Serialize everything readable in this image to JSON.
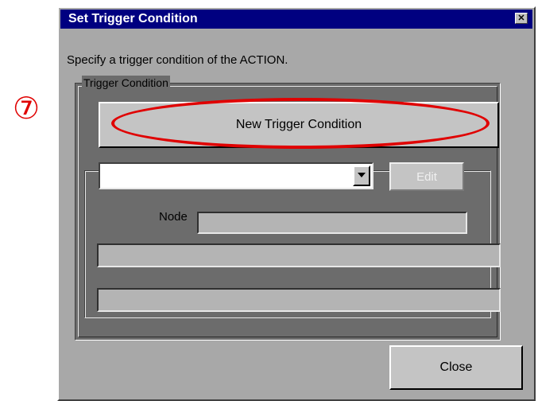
{
  "annotation": {
    "step_marker": "⑦",
    "highlight_color": "#e00000"
  },
  "window": {
    "title": "Set Trigger Condition",
    "close_glyph": "✕",
    "titlebar_color": "#000080"
  },
  "instruction": "Specify a trigger condition of the ACTION.",
  "trigger_group": {
    "label": "Trigger Condition",
    "new_button_label": "New Trigger Condition",
    "condition_select": {
      "value": ""
    },
    "edit_button_label": "Edit",
    "node_label": "Node",
    "node_value": "",
    "info_line_1": "",
    "info_line_2": ""
  },
  "close_button_label": "Close"
}
